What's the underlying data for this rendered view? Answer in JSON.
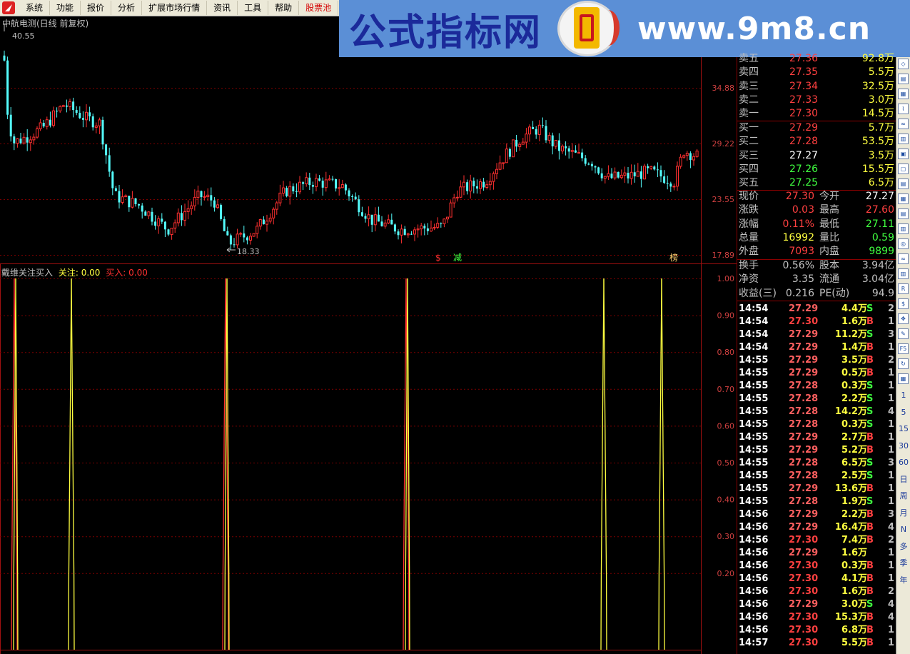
{
  "menu": [
    "系统",
    "功能",
    "报价",
    "分析",
    "扩展市场行情",
    "资讯",
    "工具",
    "帮助",
    "股票池"
  ],
  "banner": {
    "cn_title": "公式指标网",
    "url": "www.9m8.cn"
  },
  "price_panel": {
    "title": "中航电测(日线 前复权)",
    "high_label": "40.55",
    "low_label": "18.33",
    "axis_labels": [
      "34.88",
      "29.22",
      "23.55",
      "17.89"
    ],
    "markers": [
      {
        "text": "$",
        "color": "#ff3030"
      },
      {
        "text": "减",
        "color": "#40ff40"
      },
      {
        "text": "榜",
        "color": "#ffd070"
      }
    ],
    "colors": {
      "up": "#ff3030",
      "down": "#54fcfc"
    }
  },
  "indicator_panel": {
    "name": "戴维关注买入",
    "guanzhu_label": "关注:",
    "guanzhu_value": "0.00",
    "mairu_label": "买入:",
    "mairu_value": "0.00",
    "axis_labels": [
      "1.00",
      "0.90",
      "0.80",
      "0.70",
      "0.60",
      "0.50",
      "0.40",
      "0.30",
      "0.20"
    ]
  },
  "quote": {
    "asks": [
      {
        "label": "卖五",
        "price": "27.36",
        "vol": "92.8万"
      },
      {
        "label": "卖四",
        "price": "27.35",
        "vol": "5.5万"
      },
      {
        "label": "卖三",
        "price": "27.34",
        "vol": "32.5万"
      },
      {
        "label": "卖二",
        "price": "27.33",
        "vol": "3.0万"
      },
      {
        "label": "卖一",
        "price": "27.30",
        "vol": "14.5万"
      }
    ],
    "bids": [
      {
        "label": "买一",
        "price": "27.29",
        "vol": "5.7万",
        "color": "#ff4040"
      },
      {
        "label": "买二",
        "price": "27.28",
        "vol": "53.5万",
        "color": "#ff4040"
      },
      {
        "label": "买三",
        "price": "27.27",
        "vol": "3.5万",
        "color": "#ffffff"
      },
      {
        "label": "买四",
        "price": "27.26",
        "vol": "15.5万",
        "color": "#40ff40"
      },
      {
        "label": "买五",
        "price": "27.25",
        "vol": "6.5万",
        "color": "#40ff40"
      }
    ],
    "stats": [
      {
        "l1": "现价",
        "v1": "27.30",
        "c1": "#ff4040",
        "l2": "今开",
        "v2": "27.27",
        "c2": "#ffffff"
      },
      {
        "l1": "涨跌",
        "v1": "0.03",
        "c1": "#ff4040",
        "l2": "最高",
        "v2": "27.60",
        "c2": "#ff4040"
      },
      {
        "l1": "涨幅",
        "v1": "0.11%",
        "c1": "#ff4040",
        "l2": "最低",
        "v2": "27.11",
        "c2": "#40ff40"
      },
      {
        "l1": "总量",
        "v1": "16992",
        "c1": "#ffff40",
        "l2": "量比",
        "v2": "0.59",
        "c2": "#40ff40"
      },
      {
        "l1": "外盘",
        "v1": "7093",
        "c1": "#ff4040",
        "l2": "内盘",
        "v2": "9899",
        "c2": "#40ff40"
      }
    ],
    "fund": [
      {
        "l1": "换手",
        "v1": "0.56%",
        "l2": "股本",
        "v2": "3.94亿"
      },
      {
        "l1": "净资",
        "v1": "3.35",
        "l2": "流通",
        "v2": "3.04亿"
      },
      {
        "l1": "收益(三)",
        "v1": "0.216",
        "l2": "PE(动)",
        "v2": "94.9"
      }
    ]
  },
  "ticks": [
    {
      "t": "14:54",
      "p": "27.29",
      "v": "4.4万",
      "s": "S",
      "n": "2"
    },
    {
      "t": "14:54",
      "p": "27.30",
      "v": "1.6万",
      "s": "B",
      "n": "1"
    },
    {
      "t": "14:54",
      "p": "27.29",
      "v": "11.2万",
      "s": "S",
      "n": "3"
    },
    {
      "t": "14:54",
      "p": "27.29",
      "v": "1.4万",
      "s": "B",
      "n": "1"
    },
    {
      "t": "14:55",
      "p": "27.29",
      "v": "3.5万",
      "s": "B",
      "n": "2"
    },
    {
      "t": "14:55",
      "p": "27.29",
      "v": "0.5万",
      "s": "B",
      "n": "1"
    },
    {
      "t": "14:55",
      "p": "27.28",
      "v": "0.3万",
      "s": "S",
      "n": "1"
    },
    {
      "t": "14:55",
      "p": "27.28",
      "v": "2.2万",
      "s": "S",
      "n": "1"
    },
    {
      "t": "14:55",
      "p": "27.28",
      "v": "14.2万",
      "s": "S",
      "n": "4"
    },
    {
      "t": "14:55",
      "p": "27.28",
      "v": "0.3万",
      "s": "S",
      "n": "1"
    },
    {
      "t": "14:55",
      "p": "27.29",
      "v": "2.7万",
      "s": "B",
      "n": "1"
    },
    {
      "t": "14:55",
      "p": "27.29",
      "v": "5.2万",
      "s": "B",
      "n": "1"
    },
    {
      "t": "14:55",
      "p": "27.28",
      "v": "6.5万",
      "s": "S",
      "n": "3"
    },
    {
      "t": "14:55",
      "p": "27.28",
      "v": "2.5万",
      "s": "S",
      "n": "1"
    },
    {
      "t": "14:55",
      "p": "27.29",
      "v": "13.6万",
      "s": "B",
      "n": "1"
    },
    {
      "t": "14:55",
      "p": "27.28",
      "v": "1.9万",
      "s": "S",
      "n": "1"
    },
    {
      "t": "14:56",
      "p": "27.29",
      "v": "2.2万",
      "s": "B",
      "n": "3"
    },
    {
      "t": "14:56",
      "p": "27.29",
      "v": "16.4万",
      "s": "B",
      "n": "4"
    },
    {
      "t": "14:56",
      "p": "27.30",
      "v": "7.4万",
      "s": "B",
      "n": "2"
    },
    {
      "t": "14:56",
      "p": "27.29",
      "v": "1.6万",
      "s": "",
      "n": "1"
    },
    {
      "t": "14:56",
      "p": "27.30",
      "v": "0.3万",
      "s": "B",
      "n": "1"
    },
    {
      "t": "14:56",
      "p": "27.30",
      "v": "4.1万",
      "s": "B",
      "n": "1"
    },
    {
      "t": "14:56",
      "p": "27.30",
      "v": "1.6万",
      "s": "B",
      "n": "2"
    },
    {
      "t": "14:56",
      "p": "27.29",
      "v": "3.0万",
      "s": "S",
      "n": "4"
    },
    {
      "t": "14:56",
      "p": "27.30",
      "v": "15.3万",
      "s": "B",
      "n": "4"
    },
    {
      "t": "14:56",
      "p": "27.30",
      "v": "6.8万",
      "s": "B",
      "n": "1"
    },
    {
      "t": "14:57",
      "p": "27.30",
      "v": "5.5万",
      "s": "B",
      "n": "1"
    }
  ],
  "toolbar_text": [
    "1",
    "5",
    "15",
    "30",
    "60",
    "日",
    "周",
    "月",
    "N",
    "多",
    "季",
    "年"
  ],
  "toolbar_icons": [
    "Fio",
    "F10",
    "F5",
    "RSI",
    "Fiz",
    "F5",
    "RSI"
  ]
}
